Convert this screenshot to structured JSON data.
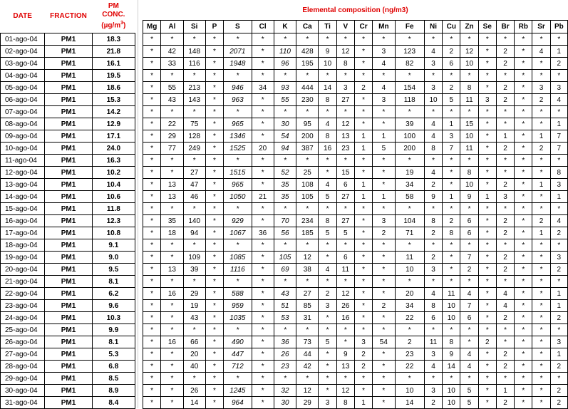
{
  "headers": {
    "date": "DATE",
    "fraction": "FRACTION",
    "pm_line1": "PM",
    "pm_line2": "CONC.",
    "pm_unit": "(µg/m",
    "pm_unit_sup": "3",
    "pm_unit_close": ")",
    "elemental": "Elemental composition (ng/m3)"
  },
  "elements": [
    "Mg",
    "Al",
    "Si",
    "P",
    "S",
    "Cl",
    "K",
    "Ca",
    "Ti",
    "V",
    "Cr",
    "Mn",
    "Fe",
    "Ni",
    "Cu",
    "Zn",
    "Se",
    "Br",
    "Rb",
    "Sr",
    "Pb"
  ],
  "rows": [
    {
      "date": "01-ago-04",
      "fraction": "PM1",
      "pm": "18.3",
      "vals": [
        "*",
        "*",
        "*",
        "*",
        "*",
        "*",
        "*",
        "*",
        "*",
        "*",
        "*",
        "*",
        "*",
        "*",
        "*",
        "*",
        "*",
        "*",
        "*",
        "*",
        "*"
      ]
    },
    {
      "date": "02-ago-04",
      "fraction": "PM1",
      "pm": "21.8",
      "vals": [
        "*",
        "42",
        "148",
        "*",
        "2071",
        "*",
        "110",
        "428",
        "9",
        "12",
        "*",
        "3",
        "123",
        "4",
        "2",
        "12",
        "*",
        "2",
        "*",
        "4",
        "1"
      ]
    },
    {
      "date": "03-ago-04",
      "fraction": "PM1",
      "pm": "16.1",
      "vals": [
        "*",
        "33",
        "116",
        "*",
        "1948",
        "*",
        "96",
        "195",
        "10",
        "8",
        "*",
        "4",
        "82",
        "3",
        "6",
        "10",
        "*",
        "2",
        "*",
        "*",
        "2"
      ]
    },
    {
      "date": "04-ago-04",
      "fraction": "PM1",
      "pm": "19.5",
      "vals": [
        "*",
        "*",
        "*",
        "*",
        "*",
        "*",
        "*",
        "*",
        "*",
        "*",
        "*",
        "*",
        "*",
        "*",
        "*",
        "*",
        "*",
        "*",
        "*",
        "*",
        "*"
      ]
    },
    {
      "date": "05-ago-04",
      "fraction": "PM1",
      "pm": "18.6",
      "vals": [
        "*",
        "55",
        "213",
        "*",
        "946",
        "34",
        "93",
        "444",
        "14",
        "3",
        "2",
        "4",
        "154",
        "3",
        "2",
        "8",
        "*",
        "2",
        "*",
        "3",
        "3"
      ]
    },
    {
      "date": "06-ago-04",
      "fraction": "PM1",
      "pm": "15.3",
      "vals": [
        "*",
        "43",
        "143",
        "*",
        "963",
        "*",
        "55",
        "230",
        "8",
        "27",
        "*",
        "3",
        "118",
        "10",
        "5",
        "11",
        "3",
        "2",
        "*",
        "2",
        "4"
      ]
    },
    {
      "date": "07-ago-04",
      "fraction": "PM1",
      "pm": "14.2",
      "vals": [
        "*",
        "*",
        "*",
        "*",
        "*",
        "*",
        "*",
        "*",
        "*",
        "*",
        "*",
        "*",
        "*",
        "*",
        "*",
        "*",
        "*",
        "*",
        "*",
        "*",
        "*"
      ]
    },
    {
      "date": "08-ago-04",
      "fraction": "PM1",
      "pm": "12.9",
      "vals": [
        "*",
        "22",
        "75",
        "*",
        "965",
        "*",
        "30",
        "95",
        "4",
        "12",
        "*",
        "*",
        "39",
        "4",
        "1",
        "15",
        "*",
        "*",
        "*",
        "*",
        "1"
      ]
    },
    {
      "date": "09-ago-04",
      "fraction": "PM1",
      "pm": "17.1",
      "vals": [
        "*",
        "29",
        "128",
        "*",
        "1346",
        "*",
        "54",
        "200",
        "8",
        "13",
        "1",
        "1",
        "100",
        "4",
        "3",
        "10",
        "*",
        "1",
        "*",
        "1",
        "7"
      ]
    },
    {
      "date": "10-ago-04",
      "fraction": "PM1",
      "pm": "24.0",
      "vals": [
        "*",
        "77",
        "249",
        "*",
        "1525",
        "20",
        "94",
        "387",
        "16",
        "23",
        "1",
        "5",
        "200",
        "8",
        "7",
        "11",
        "*",
        "2",
        "*",
        "2",
        "7"
      ]
    },
    {
      "date": "11-ago-04",
      "fraction": "PM1",
      "pm": "16.3",
      "vals": [
        "*",
        "*",
        "*",
        "*",
        "*",
        "*",
        "*",
        "*",
        "*",
        "*",
        "*",
        "*",
        "*",
        "*",
        "*",
        "*",
        "*",
        "*",
        "*",
        "*",
        "*"
      ]
    },
    {
      "date": "12-ago-04",
      "fraction": "PM1",
      "pm": "10.2",
      "vals": [
        "*",
        "*",
        "27",
        "*",
        "1515",
        "*",
        "52",
        "25",
        "*",
        "15",
        "*",
        "*",
        "19",
        "4",
        "*",
        "8",
        "*",
        "*",
        "*",
        "*",
        "8"
      ]
    },
    {
      "date": "13-ago-04",
      "fraction": "PM1",
      "pm": "10.4",
      "vals": [
        "*",
        "13",
        "47",
        "*",
        "965",
        "*",
        "35",
        "108",
        "4",
        "6",
        "1",
        "*",
        "34",
        "2",
        "*",
        "10",
        "*",
        "2",
        "*",
        "1",
        "3"
      ]
    },
    {
      "date": "14-ago-04",
      "fraction": "PM1",
      "pm": "10.6",
      "vals": [
        "*",
        "13",
        "46",
        "*",
        "1050",
        "21",
        "35",
        "105",
        "5",
        "27",
        "1",
        "1",
        "58",
        "9",
        "1",
        "9",
        "1",
        "3",
        "*",
        "*",
        "1"
      ]
    },
    {
      "date": "15-ago-04",
      "fraction": "PM1",
      "pm": "11.8",
      "vals": [
        "*",
        "*",
        "*",
        "*",
        "*",
        "*",
        "*",
        "*",
        "*",
        "*",
        "*",
        "*",
        "*",
        "*",
        "*",
        "*",
        "*",
        "*",
        "*",
        "*",
        "*"
      ]
    },
    {
      "date": "16-ago-04",
      "fraction": "PM1",
      "pm": "12.3",
      "vals": [
        "*",
        "35",
        "140",
        "*",
        "929",
        "*",
        "70",
        "234",
        "8",
        "27",
        "*",
        "3",
        "104",
        "8",
        "2",
        "6",
        "*",
        "2",
        "*",
        "2",
        "4"
      ]
    },
    {
      "date": "17-ago-04",
      "fraction": "PM1",
      "pm": "10.8",
      "vals": [
        "*",
        "18",
        "94",
        "*",
        "1067",
        "36",
        "56",
        "185",
        "5",
        "5",
        "*",
        "2",
        "71",
        "2",
        "8",
        "6",
        "*",
        "2",
        "*",
        "1",
        "2"
      ]
    },
    {
      "date": "18-ago-04",
      "fraction": "PM1",
      "pm": "9.1",
      "vals": [
        "*",
        "*",
        "*",
        "*",
        "*",
        "*",
        "*",
        "*",
        "*",
        "*",
        "*",
        "*",
        "*",
        "*",
        "*",
        "*",
        "*",
        "*",
        "*",
        "*",
        "*"
      ]
    },
    {
      "date": "19-ago-04",
      "fraction": "PM1",
      "pm": "9.0",
      "vals": [
        "*",
        "*",
        "109",
        "*",
        "1085",
        "*",
        "105",
        "12",
        "*",
        "6",
        "*",
        "*",
        "11",
        "2",
        "*",
        "7",
        "*",
        "2",
        "*",
        "*",
        "3"
      ]
    },
    {
      "date": "20-ago-04",
      "fraction": "PM1",
      "pm": "9.5",
      "vals": [
        "*",
        "13",
        "39",
        "*",
        "1116",
        "*",
        "69",
        "38",
        "4",
        "11",
        "*",
        "*",
        "10",
        "3",
        "*",
        "2",
        "*",
        "2",
        "*",
        "*",
        "2"
      ]
    },
    {
      "date": "21-ago-04",
      "fraction": "PM1",
      "pm": "8.1",
      "vals": [
        "*",
        "*",
        "*",
        "*",
        "*",
        "*",
        "*",
        "*",
        "*",
        "*",
        "*",
        "*",
        "*",
        "*",
        "*",
        "*",
        "*",
        "*",
        "*",
        "*",
        "*"
      ]
    },
    {
      "date": "22-ago-04",
      "fraction": "PM1",
      "pm": "6.2",
      "vals": [
        "*",
        "16",
        "29",
        "*",
        "588",
        "*",
        "43",
        "27",
        "2",
        "12",
        "*",
        "*",
        "20",
        "4",
        "11",
        "4",
        "*",
        "4",
        "*",
        "*",
        "1"
      ]
    },
    {
      "date": "23-ago-04",
      "fraction": "PM1",
      "pm": "9.6",
      "vals": [
        "*",
        "*",
        "19",
        "*",
        "959",
        "*",
        "51",
        "85",
        "3",
        "26",
        "*",
        "2",
        "34",
        "8",
        "10",
        "7",
        "*",
        "4",
        "*",
        "*",
        "1"
      ]
    },
    {
      "date": "24-ago-04",
      "fraction": "PM1",
      "pm": "10.3",
      "vals": [
        "*",
        "*",
        "43",
        "*",
        "1035",
        "*",
        "53",
        "31",
        "*",
        "16",
        "*",
        "*",
        "22",
        "6",
        "10",
        "6",
        "*",
        "2",
        "*",
        "*",
        "2"
      ]
    },
    {
      "date": "25-ago-04",
      "fraction": "PM1",
      "pm": "9.9",
      "vals": [
        "*",
        "*",
        "*",
        "*",
        "*",
        "*",
        "*",
        "*",
        "*",
        "*",
        "*",
        "*",
        "*",
        "*",
        "*",
        "*",
        "*",
        "*",
        "*",
        "*",
        "*"
      ]
    },
    {
      "date": "26-ago-04",
      "fraction": "PM1",
      "pm": "8.1",
      "vals": [
        "*",
        "16",
        "66",
        "*",
        "490",
        "*",
        "36",
        "73",
        "5",
        "*",
        "3",
        "54",
        "2",
        "11",
        "8",
        "*",
        "2",
        "*",
        "*",
        "*",
        "3"
      ]
    },
    {
      "date": "27-ago-04",
      "fraction": "PM1",
      "pm": "5.3",
      "vals": [
        "*",
        "*",
        "20",
        "*",
        "447",
        "*",
        "26",
        "44",
        "*",
        "9",
        "2",
        "*",
        "23",
        "3",
        "9",
        "4",
        "*",
        "2",
        "*",
        "*",
        "1"
      ]
    },
    {
      "date": "28-ago-04",
      "fraction": "PM1",
      "pm": "6.8",
      "vals": [
        "*",
        "*",
        "40",
        "*",
        "712",
        "*",
        "23",
        "42",
        "*",
        "13",
        "2",
        "*",
        "22",
        "4",
        "14",
        "4",
        "*",
        "2",
        "*",
        "*",
        "2"
      ]
    },
    {
      "date": "29-ago-04",
      "fraction": "PM1",
      "pm": "8.5",
      "vals": [
        "*",
        "*",
        "*",
        "*",
        "*",
        "*",
        "*",
        "*",
        "*",
        "*",
        "*",
        "*",
        "*",
        "*",
        "*",
        "*",
        "*",
        "*",
        "*",
        "*",
        "*"
      ]
    },
    {
      "date": "30-ago-04",
      "fraction": "PM1",
      "pm": "8.9",
      "vals": [
        "*",
        "*",
        "26",
        "*",
        "1245",
        "*",
        "32",
        "12",
        "*",
        "12",
        "*",
        "*",
        "10",
        "3",
        "10",
        "5",
        "*",
        "1",
        "*",
        "*",
        "2"
      ]
    },
    {
      "date": "31-ago-04",
      "fraction": "PM1",
      "pm": "8.4",
      "vals": [
        "*",
        "*",
        "14",
        "*",
        "964",
        "*",
        "30",
        "29",
        "3",
        "8",
        "1",
        "*",
        "14",
        "2",
        "10",
        "5",
        "*",
        "2",
        "*",
        "*",
        "2"
      ]
    }
  ],
  "italic_columns": [
    "S",
    "K"
  ]
}
